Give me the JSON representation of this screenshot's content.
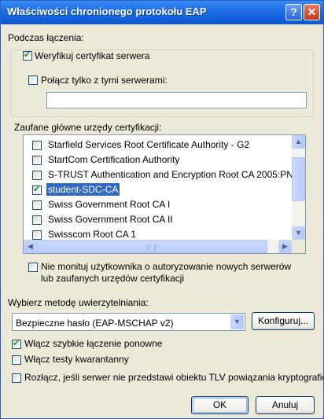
{
  "window": {
    "title": "Właściwości chronionego protokołu EAP",
    "help_button": "?",
    "close_button": "✕"
  },
  "connecting": {
    "label": "Podczas łączenia:",
    "verify_certificate": {
      "label": "Weryfikuj certyfikat serwera",
      "checked": true
    },
    "connect_to_servers": {
      "label": "Połącz tylko z tymi serwerami:",
      "checked": false,
      "value": ""
    },
    "trusted_ca_label": "Zaufane główne urzędy certyfikacji:",
    "trusted_ca_list": [
      {
        "label": "Starfield Services Root Certificate Authority - G2",
        "checked": false,
        "selected": false
      },
      {
        "label": "StartCom Certification Authority",
        "checked": false,
        "selected": false
      },
      {
        "label": "S-TRUST Authentication and Encryption Root CA 2005:PN",
        "checked": false,
        "selected": false
      },
      {
        "label": "student-SDC-CA",
        "checked": true,
        "selected": true
      },
      {
        "label": "Swiss Government Root CA I",
        "checked": false,
        "selected": false
      },
      {
        "label": "Swiss Government Root CA II",
        "checked": false,
        "selected": false
      },
      {
        "label": "Swisscom Root CA 1",
        "checked": false,
        "selected": false
      }
    ],
    "dont_prompt": {
      "line1": "Nie monituj użytkownika o autoryzowanie nowych serwerów",
      "line2": "lub zaufanych urzędów certyfikacji",
      "checked": false
    }
  },
  "auth_method": {
    "label": "Wybierz metodę uwierzytelniania:",
    "selected": "Bezpieczne hasło (EAP-MSCHAP v2)",
    "configure_button": "Konfiguruj..."
  },
  "options": {
    "fast_reconnect": {
      "label": "Włącz szybkie łączenie ponowne",
      "checked": true
    },
    "quarantine_checks": {
      "label": "Włącz testy kwarantanny",
      "checked": false
    },
    "disconnect_tlv": {
      "label": "Rozłącz, jeśli serwer nie przedstawi obiektu TLV powiązania kryptograficznego",
      "checked": false
    }
  },
  "buttons": {
    "ok": "OK",
    "cancel": "Anuluj"
  },
  "colors": {
    "title_bar": "#0b57d2",
    "selection": "#316ac5",
    "dialog_bg": "#ece9d8"
  }
}
